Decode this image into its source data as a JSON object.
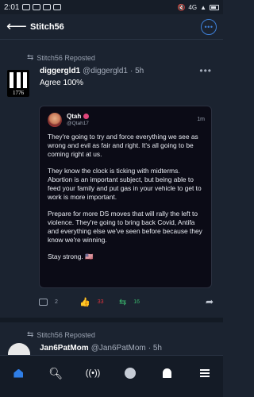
{
  "status": {
    "time": "2:01",
    "network": "4G"
  },
  "header": {
    "title": "Stitch56"
  },
  "posts": [
    {
      "repost_label": "Stitch56 Reposted",
      "display_name": "diggergld1",
      "handle": "@diggergld1",
      "age": "· 5h",
      "avatar_text": "1776",
      "body": "Agree 100%",
      "quote": {
        "display_name": "Qtah",
        "handle": "@Qtah17",
        "age": "1m",
        "paragraphs": [
          "They're going to try and force everything we see as wrong and evil as fair and right. It's all going to be coming right at us.",
          "They know the clock is ticking with midterms. Abortion is an important subject, but being able to feed your family and put gas in your vehicle to get to work is more important.",
          "Prepare for more DS moves that will rally the left to violence. They're going to bring back Covid, Antifa and everything else we've seen before because they know we're winning.",
          "Stay strong. 🇺🇸"
        ]
      },
      "counts": {
        "comments": "2",
        "likes": "33",
        "reposts": "16"
      }
    },
    {
      "repost_label": "Stitch56 Reposted",
      "display_name": "Jan6PatMom",
      "handle": "@Jan6PatMom",
      "age": "· 5h"
    }
  ],
  "icons": {
    "back": "arrow-left-icon",
    "more": "ellipsis-icon",
    "repost": "repost-icon",
    "comment": "comment-icon",
    "like": "thumbs-up-icon",
    "share": "share-arrow-icon"
  },
  "colors": {
    "accent": "#2f7ee6",
    "like": "#e0333c",
    "repost": "#39b36b",
    "background": "#1b2330"
  },
  "nav": {
    "items": [
      "home",
      "search",
      "live",
      "profile",
      "notifications",
      "menu"
    ],
    "active": "home"
  }
}
